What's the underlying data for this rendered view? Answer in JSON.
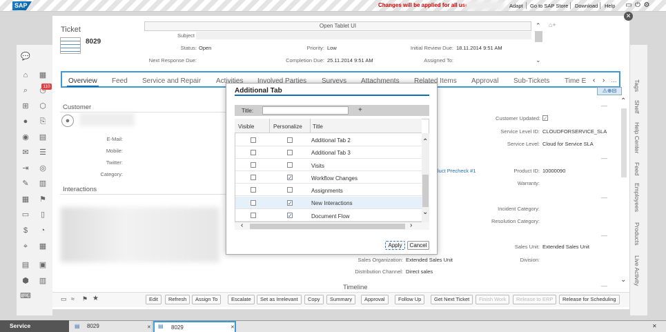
{
  "shell": {
    "logo": "SAP",
    "notice": "Changes will be applied for all users",
    "links": [
      "Adapt",
      "Go to SAP Store",
      "Download",
      "Help"
    ]
  },
  "ticket": {
    "heading": "Ticket",
    "number": "8029",
    "open_tablet": "Open Tablet UI",
    "subject_label": "Subject",
    "status_label": "Status:",
    "status": "Open",
    "priority_label": "Priority:",
    "priority": "Low",
    "initial_review_label": "Initial Review Due:",
    "initial_review": "18.11.2014 9:51 AM",
    "next_response_label": "Next Response Due:",
    "completion_label": "Completion Due:",
    "completion": "25.11.2014 9:51 AM",
    "assigned_label": "Assigned To:"
  },
  "tabs": [
    "Overview",
    "Feed",
    "Service and Repair",
    "Activities",
    "Involved Parties",
    "Surveys",
    "Attachments",
    "Related Items",
    "Approval",
    "Sub-Tickets",
    "Time E"
  ],
  "customer": {
    "section": "Customer",
    "email": "E-Mail:",
    "mobile": "Mobile:",
    "twitter": "Twitter:",
    "category": "Category:",
    "interactions": "Interactions"
  },
  "right_fields": {
    "customer_updated_label": "Customer Updated:",
    "service_level_id_label": "Service Level ID:",
    "service_level_id": "CLOUDFORSERVICE_SLA",
    "service_level_label": "Service Level:",
    "service_level": "Cloud for Service SLA",
    "product_link": "luct Precheck #1",
    "product_id_label": "Product ID:",
    "product_id": "10000090",
    "warranty_label": "Warranty:",
    "incident_label": "Incident Category:",
    "resolution_label": "Resolution Category:",
    "sales_unit_label": "Sales Unit:",
    "sales_unit": "Extended Sales Unit",
    "division_label": "Division:",
    "sales_org_label": "Sales Organization:",
    "sales_org": "Extended Sales Unit",
    "dist_channel_label": "Distribution Channel:",
    "dist_channel": "Direct sales",
    "timeline": "Timeline"
  },
  "left_nav_icons": [
    "chat-icon",
    "home-icon",
    "calendar-icon",
    "search-icon",
    "alert-icon",
    "org-icon",
    "box-icon",
    "person-icon",
    "document-search-icon",
    "contact-icon",
    "doc-icon",
    "mail-icon",
    "list-icon",
    "login-icon",
    "coin-icon",
    "edit-icon",
    "report-icon",
    "calendar2-icon",
    "ticket-icon",
    "message-icon",
    "tablet-icon",
    "money-icon",
    "pie-icon",
    "map-icon",
    "calendar3-icon",
    "ledger-icon",
    "clipboard-icon",
    "cube-icon",
    "docs-icon",
    "keyboard-icon"
  ],
  "badge": "110",
  "right_tabs": [
    "Tags",
    "Shelf",
    "Help Center",
    "Feed",
    "Employees",
    "Products",
    "Live Activity"
  ],
  "toolbar": {
    "buttons": [
      "Edit",
      "Refresh",
      "Assign To",
      "Escalate",
      "Set as Irrelevant",
      "Copy",
      "Summary",
      "Approval",
      "Follow Up",
      "Get Next Ticket",
      "Finish Work",
      "Release to ERP",
      "Release for Scheduling"
    ]
  },
  "status_bar": {
    "service": "Service",
    "window1": "8029",
    "window2": "8029"
  },
  "dialog": {
    "title": "Additional Tab",
    "title_label": "Title:",
    "add": "+",
    "col_visible": "Visible",
    "col_personalize": "Personalize",
    "col_title": "Title",
    "rows": [
      {
        "title": "Additional Tab 2",
        "visible": false,
        "personalize": false
      },
      {
        "title": "Additional Tab 3",
        "visible": false,
        "personalize": false
      },
      {
        "title": "Visits",
        "visible": false,
        "personalize": false
      },
      {
        "title": "Workflow Changes",
        "visible": false,
        "personalize": true
      },
      {
        "title": "Assignments",
        "visible": false,
        "personalize": false
      },
      {
        "title": "New Interactions",
        "visible": false,
        "personalize": true
      },
      {
        "title": "Document Flow",
        "visible": false,
        "personalize": true
      }
    ],
    "apply": "Apply",
    "cancel": "Cancel"
  }
}
